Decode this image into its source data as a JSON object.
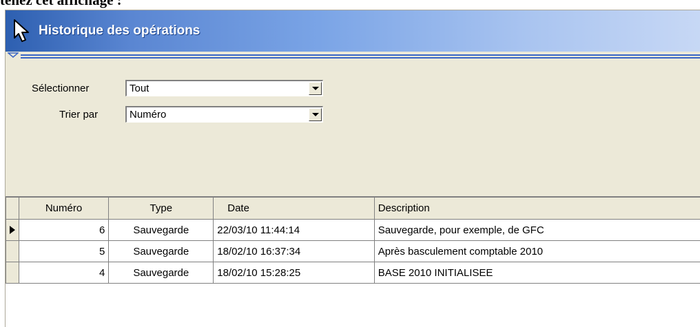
{
  "doc_text": "tenez cet affichage :",
  "window": {
    "title": "Historique des opérations"
  },
  "filters": {
    "select_label": "Sélectionner",
    "select_value": "Tout",
    "sort_label": "Trier par",
    "sort_value": "Numéro"
  },
  "grid": {
    "columns": [
      "Numéro",
      "Type",
      "Date",
      "Description"
    ],
    "rows": [
      {
        "numero": "6",
        "type": "Sauvegarde",
        "date": "22/03/10 11:44:14",
        "description": "Sauvegarde, pour exemple, de GFC",
        "current": true
      },
      {
        "numero": "5",
        "type": "Sauvegarde",
        "date": "18/02/10 16:37:34",
        "description": "Après basculement comptable 2010",
        "current": false
      },
      {
        "numero": "4",
        "type": "Sauvegarde",
        "date": "18/02/10 15:28:25",
        "description": "BASE 2010 INITIALISEE",
        "current": false
      }
    ]
  },
  "colors": {
    "title_gradient_start": "#2d5fb0",
    "title_gradient_end": "#c7d8f5",
    "window_bg": "#ece9d8",
    "splitter": "#3a66c6"
  },
  "icons": {
    "title": "mouse-pointer-icon",
    "row_indicator": "current-row-arrow-icon",
    "combo": "chevron-down-icon"
  }
}
